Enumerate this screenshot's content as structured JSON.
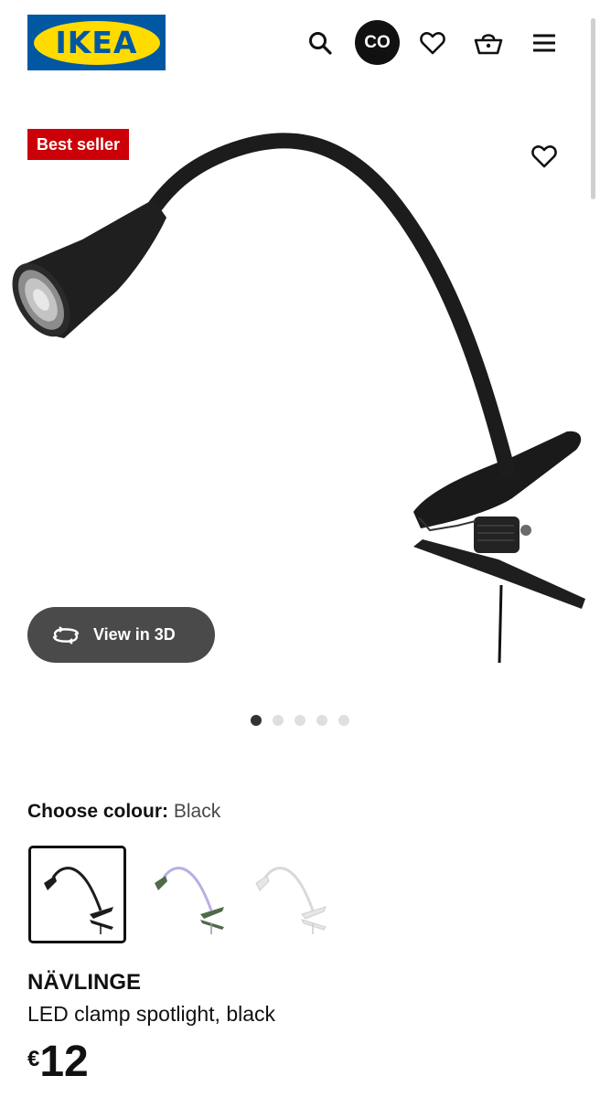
{
  "header": {
    "logo_text": "IKEA",
    "avatar_initials": "CO",
    "icons": [
      "search-icon",
      "heart-icon",
      "basket-icon",
      "menu-icon"
    ]
  },
  "badge": {
    "label": "Best seller",
    "color": "#cc0008"
  },
  "gallery": {
    "view3d_label": "View in 3D",
    "dot_count": 5,
    "active_index": 0
  },
  "colour": {
    "label": "Choose colour:",
    "selected": "Black",
    "options": [
      "black",
      "green-lilac",
      "white"
    ]
  },
  "product": {
    "name": "NÄVLINGE",
    "description": "LED clamp spotlight, black",
    "currency": "€",
    "price": "12"
  },
  "colors": {
    "ikea_blue": "#0058a3",
    "ikea_yellow": "#ffdb00",
    "badge_red": "#cc0008"
  }
}
